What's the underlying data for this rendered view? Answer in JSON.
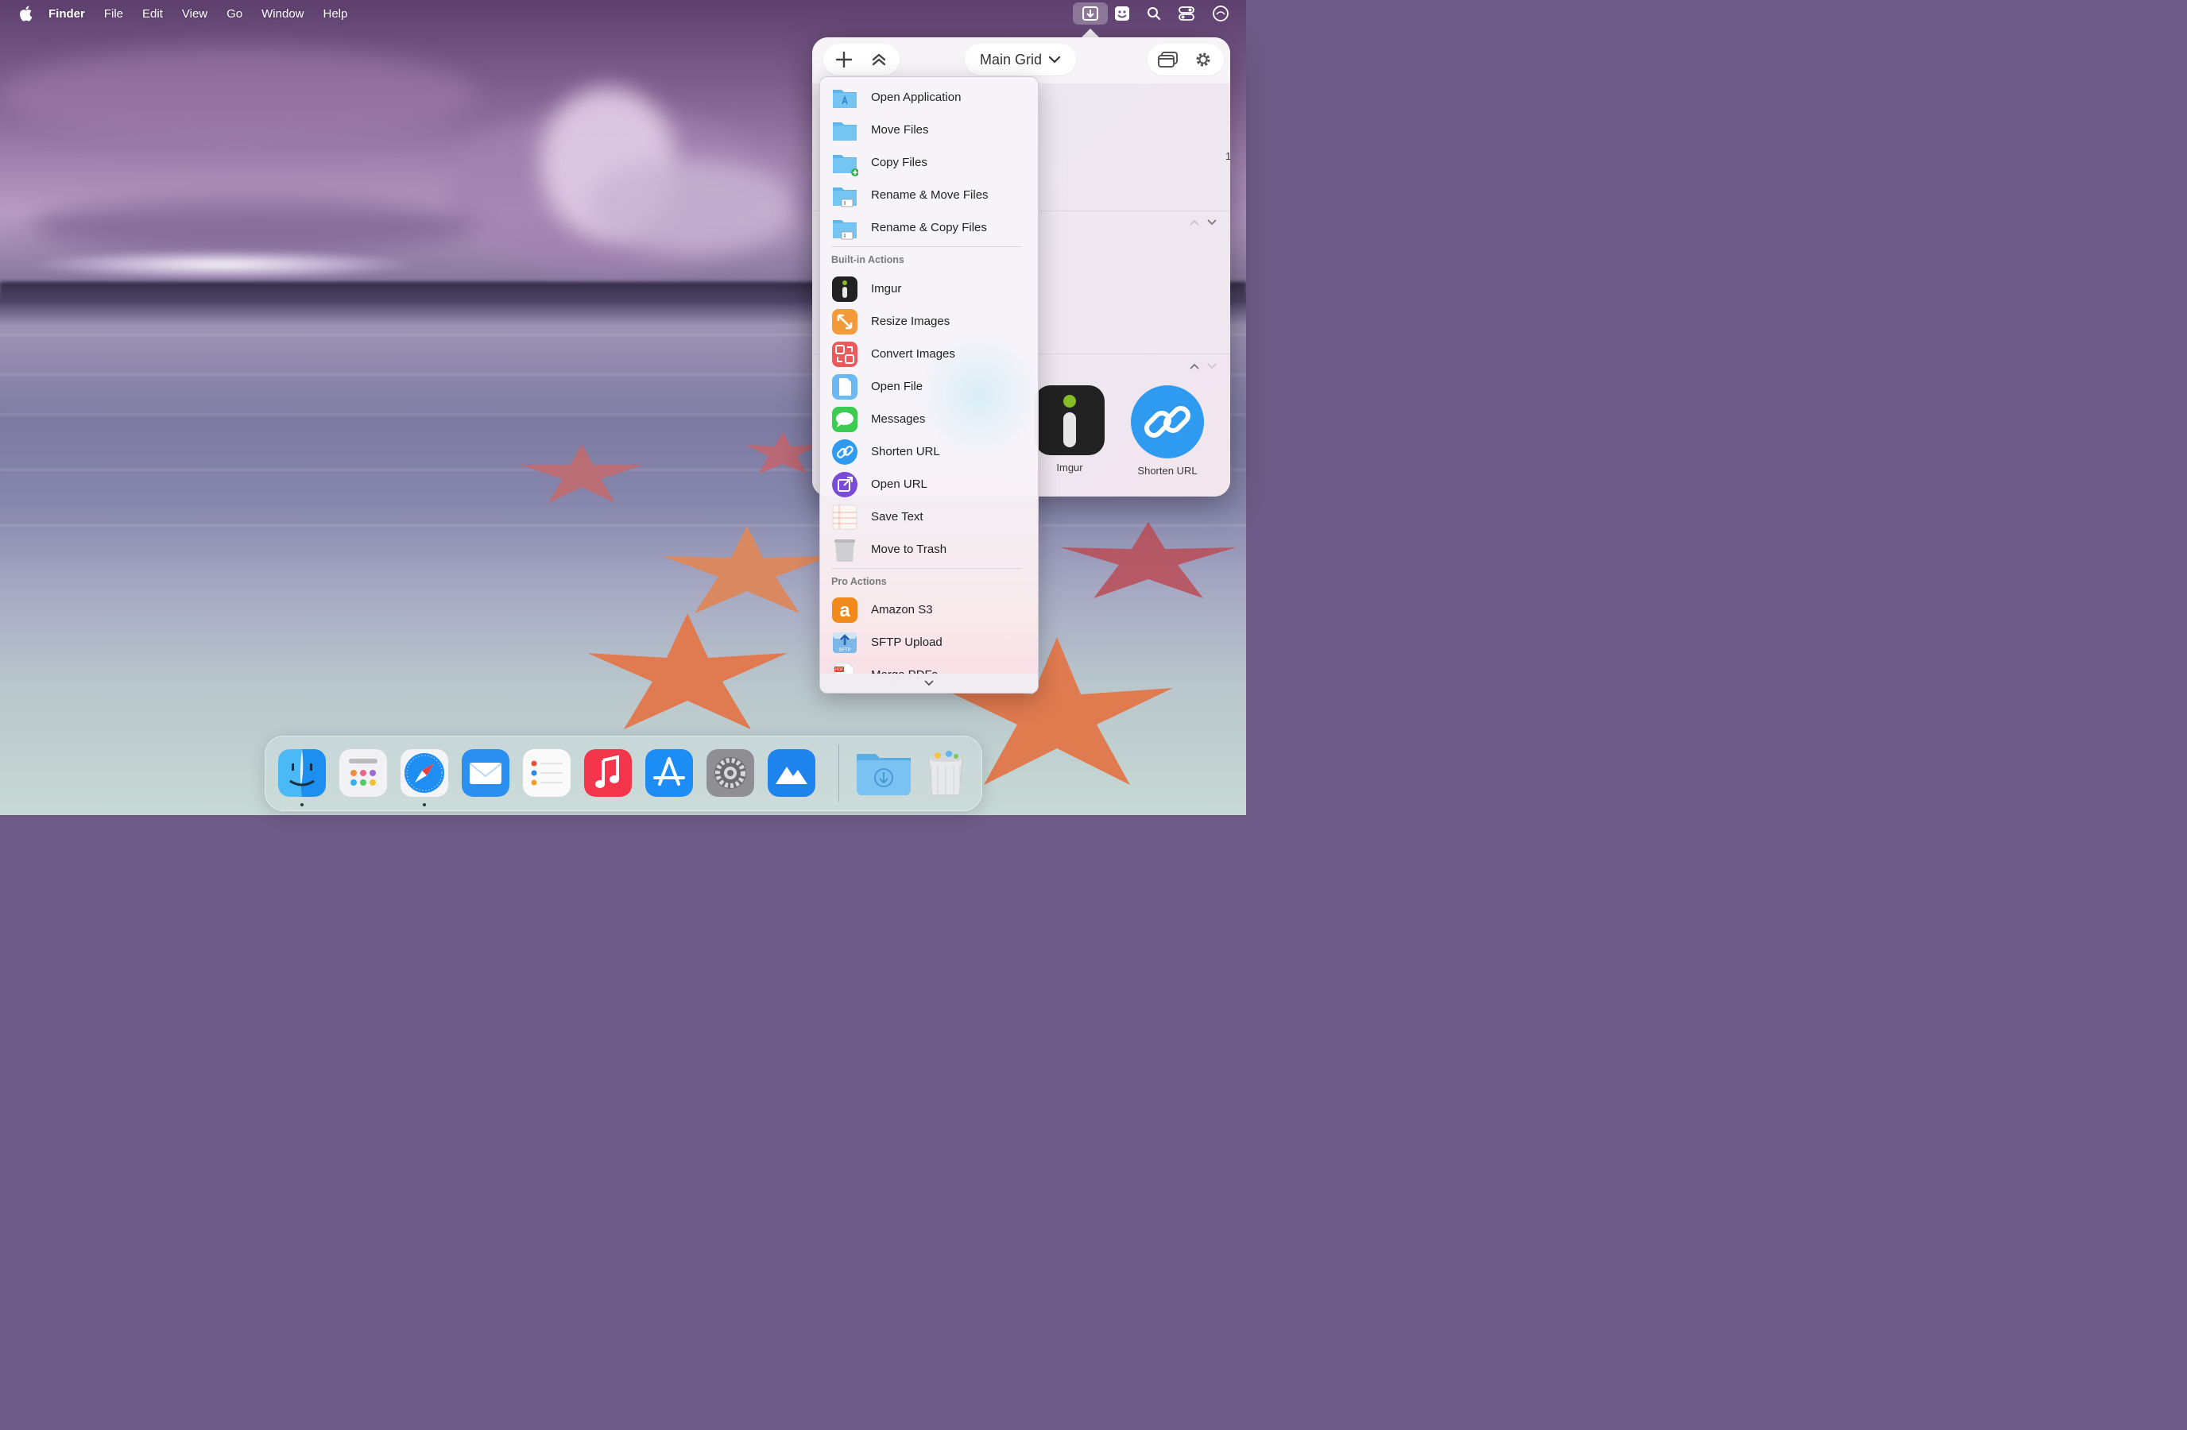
{
  "menubar": {
    "app_name": "Finder",
    "menus": [
      "File",
      "Edit",
      "View",
      "Go",
      "Window",
      "Help"
    ],
    "status_icons": [
      "dropzone-icon",
      "app-face-icon",
      "spotlight-search-icon",
      "control-center-icon",
      "siri-icon"
    ]
  },
  "popover": {
    "title": "Main Grid",
    "buttons": [
      "add-icon",
      "collapse-all-icon",
      "window-icon",
      "gear-icon"
    ],
    "partial_text": "1",
    "tiles": [
      {
        "label": "Imgur",
        "icon": "imgur-icon"
      },
      {
        "label": "Shorten URL",
        "icon": "link-icon"
      }
    ]
  },
  "dropdown": {
    "top_items": [
      {
        "label": "Open Application",
        "icon": "folder-apps-icon"
      },
      {
        "label": "Move Files",
        "icon": "folder-icon"
      },
      {
        "label": "Copy Files",
        "icon": "folder-plus-icon"
      },
      {
        "label": "Rename & Move Files",
        "icon": "folder-rename-icon"
      },
      {
        "label": "Rename & Copy Files",
        "icon": "folder-rename-icon"
      }
    ],
    "builtin_header": "Built-in Actions",
    "builtin_items": [
      {
        "label": "Imgur",
        "icon": "imgur-icon"
      },
      {
        "label": "Resize Images",
        "icon": "resize-icon"
      },
      {
        "label": "Convert Images",
        "icon": "convert-icon"
      },
      {
        "label": "Open File",
        "icon": "file-icon"
      },
      {
        "label": "Messages",
        "icon": "messages-icon"
      },
      {
        "label": "Shorten URL",
        "icon": "link-icon"
      },
      {
        "label": "Open URL",
        "icon": "open-url-icon"
      },
      {
        "label": "Save Text",
        "icon": "notepad-icon"
      },
      {
        "label": "Move to Trash",
        "icon": "trash-icon"
      }
    ],
    "pro_header": "Pro Actions",
    "pro_items": [
      {
        "label": "Amazon S3",
        "icon": "amazon-icon"
      },
      {
        "label": "SFTP Upload",
        "icon": "sftp-icon"
      },
      {
        "label": "Merge PDFs",
        "icon": "pdf-icon"
      }
    ]
  },
  "dock": {
    "apps": [
      {
        "name": "Finder",
        "icon": "finder-icon",
        "running": true
      },
      {
        "name": "Launchpad",
        "icon": "launchpad-icon",
        "running": false
      },
      {
        "name": "Safari",
        "icon": "safari-icon",
        "running": true
      },
      {
        "name": "Mail",
        "icon": "mail-icon",
        "running": false
      },
      {
        "name": "Reminders",
        "icon": "reminders-icon",
        "running": false
      },
      {
        "name": "Music",
        "icon": "music-icon",
        "running": false
      },
      {
        "name": "App Store",
        "icon": "app-store-icon",
        "running": false
      },
      {
        "name": "System Settings",
        "icon": "settings-icon",
        "running": false
      },
      {
        "name": "Dropzone",
        "icon": "dropzone-app-icon",
        "running": false
      }
    ],
    "extras": [
      {
        "name": "Downloads",
        "icon": "downloads-folder-icon"
      },
      {
        "name": "Trash",
        "icon": "trash-full-icon"
      }
    ]
  },
  "colors": {
    "accent_blue": "#2f9bf0",
    "menu_text": "#222222",
    "header_text": "#7a7a7a"
  }
}
